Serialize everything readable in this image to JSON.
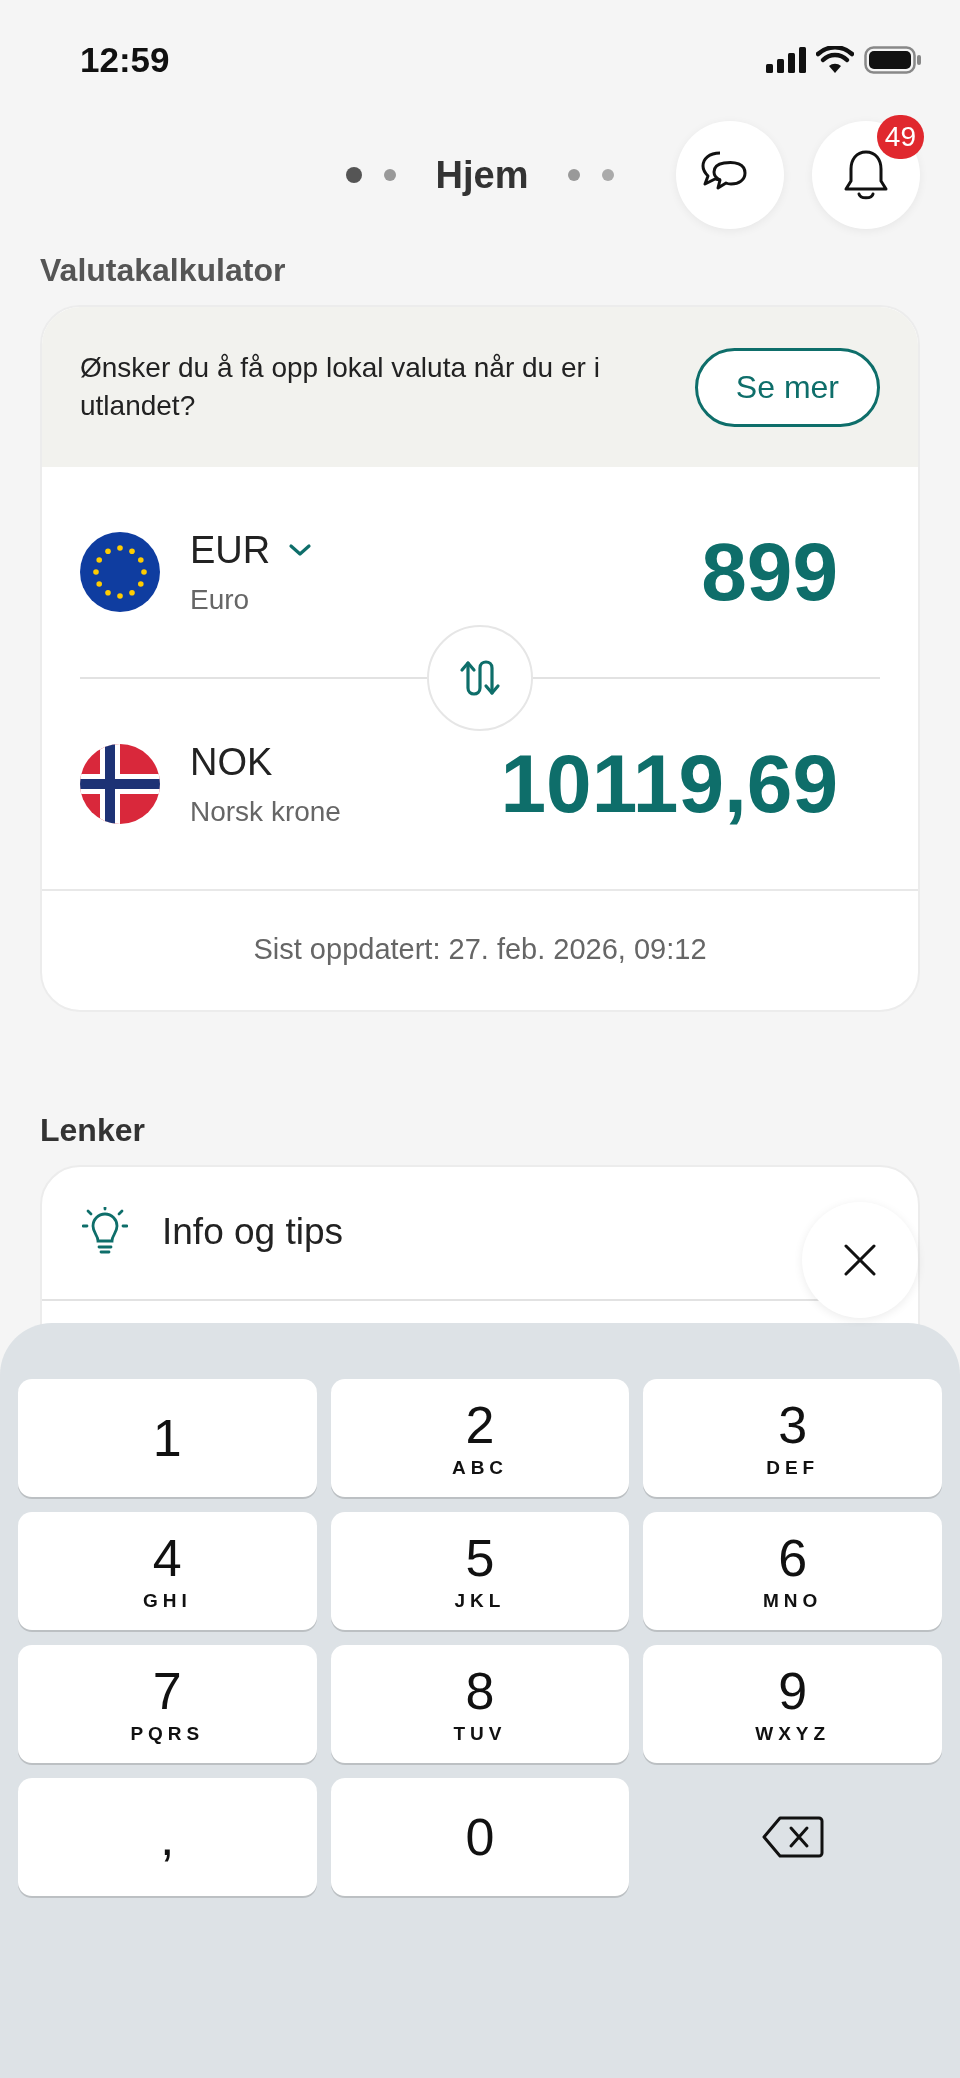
{
  "status_bar": {
    "time": "12:59"
  },
  "header": {
    "title": "Hjem",
    "notifications_badge": "49"
  },
  "calculator": {
    "heading": "Valutakalkulator",
    "prompt": "Ønsker du å få opp lokal valuta når du er i utlandet?",
    "prompt_button": "Se mer",
    "currencies": [
      {
        "code": "EUR",
        "name": "Euro",
        "amount": "899",
        "kind": "eu",
        "dropdown": true
      },
      {
        "code": "NOK",
        "name": "Norsk krone",
        "amount": "10119,69",
        "kind": "no",
        "dropdown": false
      }
    ],
    "updated": "Sist oppdatert: 27. feb. 2026, 09:12"
  },
  "links": {
    "heading": "Lenker",
    "items": [
      {
        "label": "Info og tips"
      }
    ]
  },
  "keypad": {
    "keys": [
      {
        "kind": "digit",
        "digit": "1"
      },
      {
        "kind": "digit",
        "digit": "2",
        "letters": "ABC"
      },
      {
        "kind": "digit",
        "digit": "3",
        "letters": "DEF"
      },
      {
        "kind": "digit",
        "digit": "4",
        "letters": "GHI"
      },
      {
        "kind": "digit",
        "digit": "5",
        "letters": "JKL"
      },
      {
        "kind": "digit",
        "digit": "6",
        "letters": "MNO"
      },
      {
        "kind": "digit",
        "digit": "7",
        "letters": "PQRS"
      },
      {
        "kind": "digit",
        "digit": "8",
        "letters": "TUV"
      },
      {
        "kind": "digit",
        "digit": "9",
        "letters": "WXYZ"
      },
      {
        "kind": "digit",
        "digit": ","
      },
      {
        "kind": "digit",
        "digit": "0"
      },
      {
        "kind": "backspace"
      }
    ]
  }
}
